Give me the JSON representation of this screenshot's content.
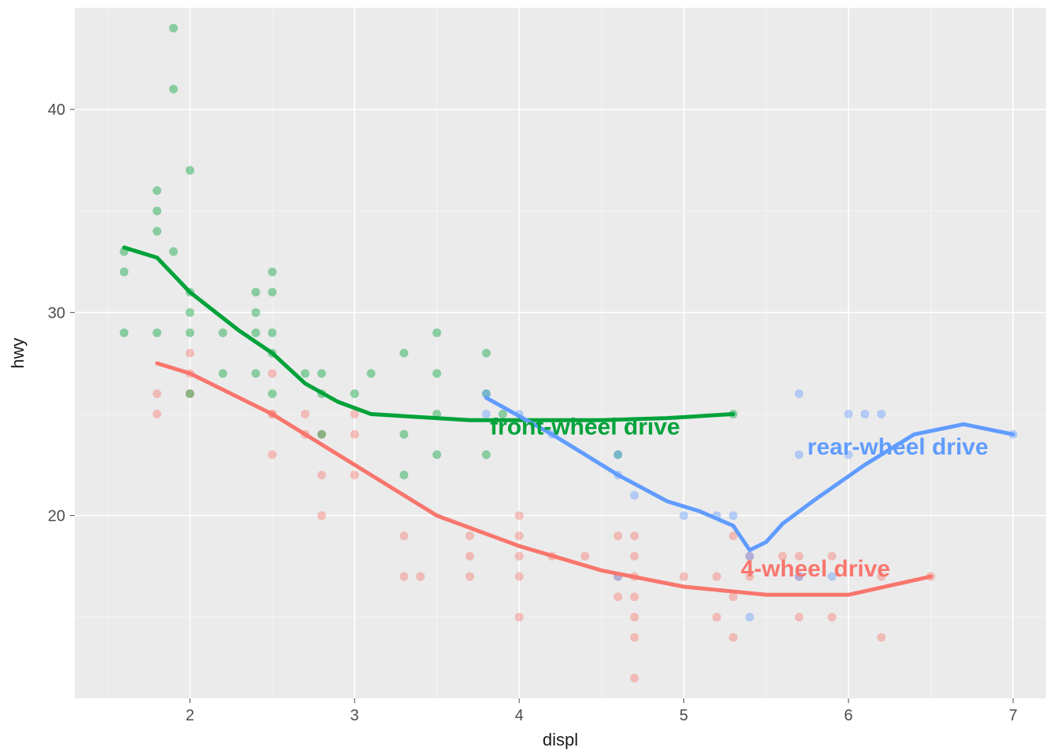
{
  "chart_data": {
    "type": "scatter",
    "xlabel": "displ",
    "ylabel": "hwy",
    "xlim": [
      1.3,
      7.2
    ],
    "ylim": [
      11,
      45
    ],
    "x_ticks": [
      2,
      3,
      4,
      5,
      6,
      7
    ],
    "y_ticks": [
      20,
      30,
      40
    ],
    "x_minor": [
      1.5,
      2.5,
      3.5,
      4.5,
      5.5,
      6.5
    ],
    "y_minor": [
      15,
      25,
      35,
      45
    ],
    "grid": true,
    "colors": {
      "4-wheel drive": "#F8766D",
      "front-wheel drive": "#00A23A",
      "rear-wheel drive": "#619CFF"
    },
    "annotations": [
      {
        "text": "front-wheel drive",
        "x": 4.4,
        "y": 24,
        "color": "#00A23A"
      },
      {
        "text": "rear-wheel drive",
        "x": 6.3,
        "y": 23,
        "color": "#619CFF"
      },
      {
        "text": "4-wheel drive",
        "x": 5.8,
        "y": 17,
        "color": "#F8766D"
      }
    ],
    "series": [
      {
        "name": "4-wheel drive",
        "color": "#F8766D",
        "points": [
          {
            "x": 1.8,
            "y": 26
          },
          {
            "x": 1.8,
            "y": 25
          },
          {
            "x": 2.0,
            "y": 28
          },
          {
            "x": 2.0,
            "y": 27
          },
          {
            "x": 2.0,
            "y": 26
          },
          {
            "x": 2.5,
            "y": 27
          },
          {
            "x": 2.5,
            "y": 25
          },
          {
            "x": 2.5,
            "y": 23
          },
          {
            "x": 2.5,
            "y": 25
          },
          {
            "x": 2.7,
            "y": 25
          },
          {
            "x": 2.7,
            "y": 24
          },
          {
            "x": 2.8,
            "y": 24
          },
          {
            "x": 2.8,
            "y": 22
          },
          {
            "x": 2.8,
            "y": 20
          },
          {
            "x": 3.0,
            "y": 24
          },
          {
            "x": 3.0,
            "y": 22
          },
          {
            "x": 3.0,
            "y": 25
          },
          {
            "x": 3.3,
            "y": 17
          },
          {
            "x": 3.3,
            "y": 19
          },
          {
            "x": 3.4,
            "y": 17
          },
          {
            "x": 3.7,
            "y": 19
          },
          {
            "x": 3.7,
            "y": 18
          },
          {
            "x": 3.7,
            "y": 17
          },
          {
            "x": 4.0,
            "y": 20
          },
          {
            "x": 4.0,
            "y": 19
          },
          {
            "x": 4.0,
            "y": 18
          },
          {
            "x": 4.0,
            "y": 17
          },
          {
            "x": 4.0,
            "y": 15
          },
          {
            "x": 4.2,
            "y": 18
          },
          {
            "x": 4.4,
            "y": 18
          },
          {
            "x": 4.6,
            "y": 17
          },
          {
            "x": 4.6,
            "y": 16
          },
          {
            "x": 4.6,
            "y": 19
          },
          {
            "x": 4.7,
            "y": 17
          },
          {
            "x": 4.7,
            "y": 15
          },
          {
            "x": 4.7,
            "y": 12
          },
          {
            "x": 4.7,
            "y": 14
          },
          {
            "x": 4.7,
            "y": 19
          },
          {
            "x": 4.7,
            "y": 18
          },
          {
            "x": 4.7,
            "y": 16
          },
          {
            "x": 5.0,
            "y": 17
          },
          {
            "x": 5.2,
            "y": 17
          },
          {
            "x": 5.2,
            "y": 15
          },
          {
            "x": 5.3,
            "y": 19
          },
          {
            "x": 5.3,
            "y": 14
          },
          {
            "x": 5.3,
            "y": 16
          },
          {
            "x": 5.4,
            "y": 17
          },
          {
            "x": 5.4,
            "y": 18
          },
          {
            "x": 5.6,
            "y": 18
          },
          {
            "x": 5.7,
            "y": 17
          },
          {
            "x": 5.7,
            "y": 18
          },
          {
            "x": 5.9,
            "y": 18
          },
          {
            "x": 5.9,
            "y": 15
          },
          {
            "x": 6.2,
            "y": 17
          },
          {
            "x": 6.2,
            "y": 14
          },
          {
            "x": 6.5,
            "y": 17
          },
          {
            "x": 5.7,
            "y": 15
          }
        ],
        "smooth": [
          {
            "x": 1.8,
            "y": 27.5
          },
          {
            "x": 2.0,
            "y": 27.0
          },
          {
            "x": 2.5,
            "y": 25.0
          },
          {
            "x": 3.0,
            "y": 22.5
          },
          {
            "x": 3.5,
            "y": 20.0
          },
          {
            "x": 4.0,
            "y": 18.5
          },
          {
            "x": 4.5,
            "y": 17.3
          },
          {
            "x": 5.0,
            "y": 16.5
          },
          {
            "x": 5.5,
            "y": 16.1
          },
          {
            "x": 6.0,
            "y": 16.1
          },
          {
            "x": 6.5,
            "y": 17.0
          }
        ]
      },
      {
        "name": "front-wheel drive",
        "color": "#00A23A",
        "points": [
          {
            "x": 1.6,
            "y": 33
          },
          {
            "x": 1.6,
            "y": 32
          },
          {
            "x": 1.6,
            "y": 29
          },
          {
            "x": 1.8,
            "y": 36
          },
          {
            "x": 1.8,
            "y": 29
          },
          {
            "x": 1.8,
            "y": 34
          },
          {
            "x": 1.8,
            "y": 35
          },
          {
            "x": 1.9,
            "y": 44
          },
          {
            "x": 1.9,
            "y": 41
          },
          {
            "x": 1.9,
            "y": 33
          },
          {
            "x": 2.0,
            "y": 31
          },
          {
            "x": 2.0,
            "y": 29
          },
          {
            "x": 2.0,
            "y": 30
          },
          {
            "x": 2.0,
            "y": 26
          },
          {
            "x": 2.0,
            "y": 37
          },
          {
            "x": 2.2,
            "y": 27
          },
          {
            "x": 2.2,
            "y": 29
          },
          {
            "x": 2.4,
            "y": 31
          },
          {
            "x": 2.4,
            "y": 30
          },
          {
            "x": 2.4,
            "y": 27
          },
          {
            "x": 2.4,
            "y": 29
          },
          {
            "x": 2.5,
            "y": 31
          },
          {
            "x": 2.5,
            "y": 29
          },
          {
            "x": 2.5,
            "y": 26
          },
          {
            "x": 2.5,
            "y": 28
          },
          {
            "x": 2.5,
            "y": 32
          },
          {
            "x": 2.7,
            "y": 27
          },
          {
            "x": 2.8,
            "y": 26
          },
          {
            "x": 2.8,
            "y": 27
          },
          {
            "x": 2.8,
            "y": 24
          },
          {
            "x": 3.0,
            "y": 26
          },
          {
            "x": 3.1,
            "y": 27
          },
          {
            "x": 3.3,
            "y": 28
          },
          {
            "x": 3.3,
            "y": 24
          },
          {
            "x": 3.3,
            "y": 22
          },
          {
            "x": 3.5,
            "y": 29
          },
          {
            "x": 3.5,
            "y": 27
          },
          {
            "x": 3.5,
            "y": 25
          },
          {
            "x": 3.5,
            "y": 23
          },
          {
            "x": 3.8,
            "y": 28
          },
          {
            "x": 3.8,
            "y": 26
          },
          {
            "x": 3.8,
            "y": 23
          },
          {
            "x": 3.9,
            "y": 25
          },
          {
            "x": 4.6,
            "y": 23
          },
          {
            "x": 5.3,
            "y": 25
          }
        ],
        "smooth": [
          {
            "x": 1.6,
            "y": 33.2
          },
          {
            "x": 1.8,
            "y": 32.7
          },
          {
            "x": 2.0,
            "y": 31.0
          },
          {
            "x": 2.3,
            "y": 29.1
          },
          {
            "x": 2.5,
            "y": 28.0
          },
          {
            "x": 2.7,
            "y": 26.5
          },
          {
            "x": 2.9,
            "y": 25.6
          },
          {
            "x": 3.1,
            "y": 25.0
          },
          {
            "x": 3.3,
            "y": 24.9
          },
          {
            "x": 3.7,
            "y": 24.7
          },
          {
            "x": 4.1,
            "y": 24.7
          },
          {
            "x": 4.5,
            "y": 24.7
          },
          {
            "x": 4.9,
            "y": 24.8
          },
          {
            "x": 5.3,
            "y": 25.0
          }
        ]
      },
      {
        "name": "rear-wheel drive",
        "color": "#619CFF",
        "points": [
          {
            "x": 3.8,
            "y": 26
          },
          {
            "x": 3.8,
            "y": 25
          },
          {
            "x": 4.0,
            "y": 25
          },
          {
            "x": 4.2,
            "y": 24
          },
          {
            "x": 4.6,
            "y": 23
          },
          {
            "x": 4.6,
            "y": 22
          },
          {
            "x": 4.7,
            "y": 21
          },
          {
            "x": 5.0,
            "y": 20
          },
          {
            "x": 5.2,
            "y": 20
          },
          {
            "x": 5.3,
            "y": 20
          },
          {
            "x": 5.4,
            "y": 18
          },
          {
            "x": 5.4,
            "y": 15
          },
          {
            "x": 5.7,
            "y": 26
          },
          {
            "x": 5.7,
            "y": 17
          },
          {
            "x": 5.7,
            "y": 23
          },
          {
            "x": 6.0,
            "y": 23
          },
          {
            "x": 6.0,
            "y": 25
          },
          {
            "x": 6.1,
            "y": 25
          },
          {
            "x": 6.2,
            "y": 25
          },
          {
            "x": 7.0,
            "y": 24
          },
          {
            "x": 5.9,
            "y": 17
          },
          {
            "x": 4.6,
            "y": 17
          }
        ],
        "smooth": [
          {
            "x": 3.8,
            "y": 25.8
          },
          {
            "x": 4.2,
            "y": 24.0
          },
          {
            "x": 4.6,
            "y": 22.0
          },
          {
            "x": 4.9,
            "y": 20.7
          },
          {
            "x": 5.1,
            "y": 20.2
          },
          {
            "x": 5.3,
            "y": 19.5
          },
          {
            "x": 5.4,
            "y": 18.3
          },
          {
            "x": 5.5,
            "y": 18.7
          },
          {
            "x": 5.6,
            "y": 19.6
          },
          {
            "x": 5.8,
            "y": 20.8
          },
          {
            "x": 6.1,
            "y": 22.5
          },
          {
            "x": 6.4,
            "y": 24.0
          },
          {
            "x": 6.7,
            "y": 24.5
          },
          {
            "x": 7.0,
            "y": 24.0
          }
        ]
      }
    ]
  },
  "axis": {
    "xlabel": "displ",
    "ylabel": "hwy"
  }
}
